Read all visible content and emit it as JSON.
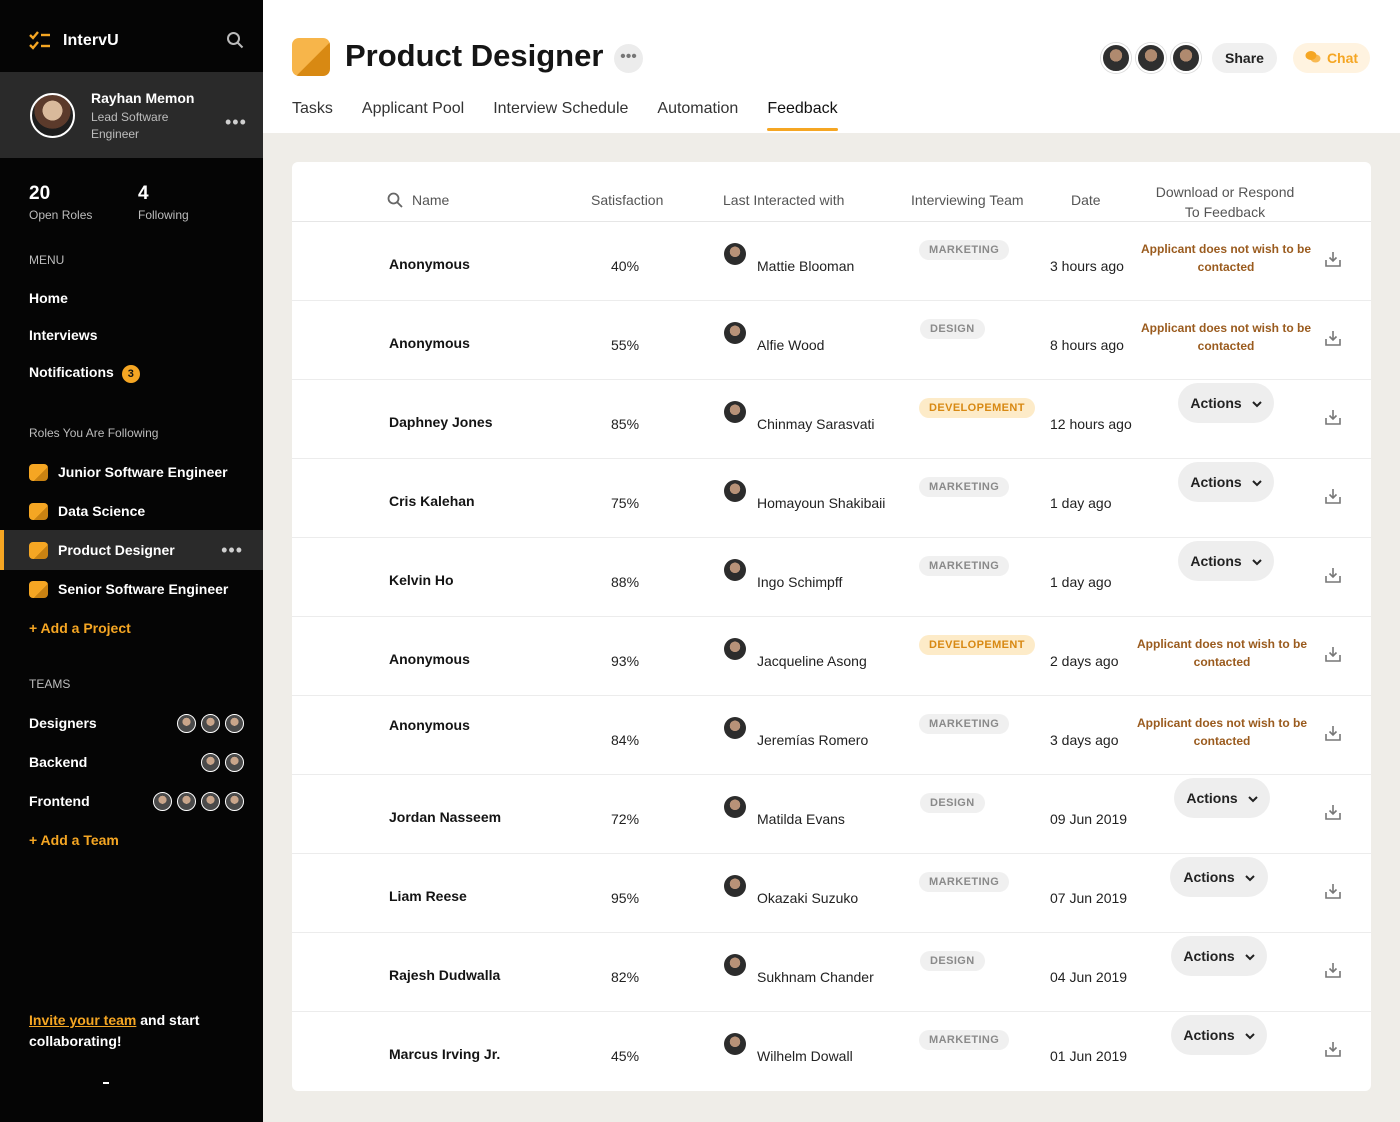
{
  "app": {
    "name": "IntervU"
  },
  "colors": {
    "accent": "#f5a623",
    "warning_text": "#9a5b1e",
    "sidebar_bg": "#050505"
  },
  "profile": {
    "name": "Rayhan Memon",
    "role": "Lead Software Engineer"
  },
  "stats": [
    {
      "value": "20",
      "label": "Open Roles"
    },
    {
      "value": "4",
      "label": "Following"
    }
  ],
  "menu": {
    "label": "MENU",
    "items": [
      "Home",
      "Interviews",
      "Notifications"
    ],
    "notification_count": "3"
  },
  "roles": {
    "label": "Roles You Are Following",
    "items": [
      "Junior Software Engineer",
      "Data Science",
      "Product Designer",
      "Senior Software Engineer"
    ],
    "active": "Product Designer",
    "add_label": "+ Add a Project"
  },
  "teams": {
    "label": "TEAMS",
    "items": [
      "Designers",
      "Backend",
      "Frontend"
    ],
    "add_label": "+ Add a Team"
  },
  "invite": {
    "link": "Invite your team",
    "rest": " and start collaborating!"
  },
  "header": {
    "title": "Product Designer",
    "share_label": "Share",
    "chat_label": "Chat",
    "tabs": [
      "Tasks",
      "Applicant Pool",
      "Interview Schedule",
      "Automation",
      "Feedback"
    ],
    "active_tab": "Feedback"
  },
  "table": {
    "columns": {
      "name": "Name",
      "satisfaction": "Satisfaction",
      "last": "Last Interacted with",
      "team": "Interviewing Team",
      "date": "Date",
      "respond": "Download or Respond To Feedback"
    },
    "actions_label": "Actions",
    "rows": [
      {
        "name": "Anonymous",
        "satisfaction": "40%",
        "person": "Mattie Blooman",
        "team": "MARKETING",
        "date": "3 hours ago",
        "response": "Applicant does not wish to be contacted"
      },
      {
        "name": "Anonymous",
        "satisfaction": "55%",
        "person": "Alfie Wood",
        "team": "DESIGN",
        "date": "8 hours ago",
        "response": "Applicant does not wish to be contacted"
      },
      {
        "name": "Daphney Jones",
        "satisfaction": "85%",
        "person": "Chinmay Sarasvati",
        "team": "DEVELOPEMENT",
        "date": "12 hours ago",
        "response": ""
      },
      {
        "name": "Cris Kalehan",
        "satisfaction": "75%",
        "person": "Homayoun Shakibaii",
        "team": "MARKETING",
        "date": "1 day ago",
        "response": ""
      },
      {
        "name": "Kelvin Ho",
        "satisfaction": "88%",
        "person": "Ingo Schimpff",
        "team": "MARKETING",
        "date": "1 day ago",
        "response": ""
      },
      {
        "name": "Anonymous",
        "satisfaction": "93%",
        "person": "Jacqueline Asong",
        "team": "DEVELOPEMENT",
        "date": "2 days ago",
        "response": "Applicant does not wish to be contacted"
      },
      {
        "name": "Anonymous",
        "satisfaction": "84%",
        "person": "Jeremías Romero",
        "team": "MARKETING",
        "date": "3 days ago",
        "response": "Applicant does not wish to be contacted"
      },
      {
        "name": "Jordan Nasseem",
        "satisfaction": "72%",
        "person": "Matilda Evans",
        "team": "DESIGN",
        "date": "09 Jun 2019",
        "response": ""
      },
      {
        "name": "Liam Reese",
        "satisfaction": "95%",
        "person": "Okazaki Suzuko",
        "team": "MARKETING",
        "date": "07 Jun 2019",
        "response": ""
      },
      {
        "name": "Rajesh Dudwalla",
        "satisfaction": "82%",
        "person": "Sukhnam Chander",
        "team": "DESIGN",
        "date": "04 Jun 2019",
        "response": ""
      },
      {
        "name": "Marcus Irving Jr.",
        "satisfaction": "45%",
        "person": "Wilhelm Dowall",
        "team": "MARKETING",
        "date": "01 Jun 2019",
        "response": ""
      }
    ]
  }
}
